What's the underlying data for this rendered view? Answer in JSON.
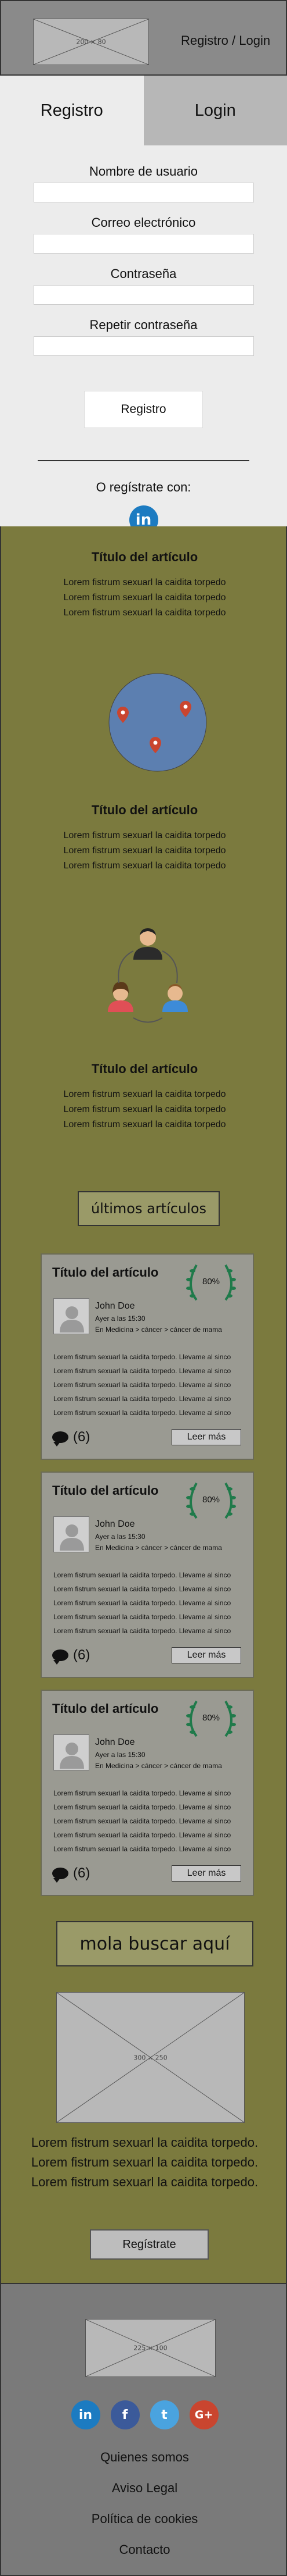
{
  "header": {
    "logo_label": "200 × 80",
    "link": "Registro / Login"
  },
  "auth": {
    "tabs": [
      {
        "label": "Registro"
      },
      {
        "label": "Login"
      }
    ],
    "fields": [
      {
        "label": "Nombre de usuario",
        "value": ""
      },
      {
        "label": "Correo electrónico",
        "value": ""
      },
      {
        "label": "Contraseña",
        "value": ""
      },
      {
        "label": "Repetir contraseña",
        "value": ""
      }
    ],
    "submit_label": "Registro",
    "or_text": "O regístrate con:",
    "linkedin_glyph": "in"
  },
  "articles": [
    {
      "title": "Título del artículo",
      "lines": [
        "Lorem fistrum sexuarl la caidita torpedo",
        "Lorem fistrum sexuarl la caidita torpedo",
        "Lorem fistrum sexuarl la caidita torpedo"
      ]
    },
    {
      "title": "Título del artículo",
      "lines": [
        "Lorem fistrum sexuarl la caidita torpedo",
        "Lorem fistrum sexuarl la caidita torpedo",
        "Lorem fistrum sexuarl la caidita torpedo"
      ]
    },
    {
      "title": "Título del artículo",
      "lines": [
        "Lorem fistrum sexuarl la caidita torpedo",
        "Lorem fistrum sexuarl la caidita torpedo",
        "Lorem fistrum sexuarl la caidita torpedo"
      ]
    }
  ],
  "latest_heading": "últimos artículos",
  "cards": [
    {
      "title": "Título del artículo",
      "rating": "80%",
      "author": "John Doe",
      "date": "Ayer a las 15:30",
      "category": "En Medicina > cáncer > cáncer de mama",
      "excerpt": [
        "Lorem fistrum sexuarl la caidita torpedo. Llevame al sinco",
        "Lorem fistrum sexuarl la caidita torpedo. Llevame al sinco",
        "Lorem fistrum sexuarl la caidita torpedo. Llevame al sinco",
        "Lorem fistrum sexuarl la caidita torpedo. Llevame al sinco",
        "Lorem fistrum sexuarl la caidita torpedo. Llevame al sinco"
      ],
      "comments": "(6)",
      "more_label": "Leer más"
    },
    {
      "title": "Título del artículo",
      "rating": "80%",
      "author": "John Doe",
      "date": "Ayer a las 15:30",
      "category": "En Medicina > cáncer > cáncer de mama",
      "excerpt": [
        "Lorem fistrum sexuarl la caidita torpedo. Llevame al sinco",
        "Lorem fistrum sexuarl la caidita torpedo. Llevame al sinco",
        "Lorem fistrum sexuarl la caidita torpedo. Llevame al sinco",
        "Lorem fistrum sexuarl la caidita torpedo. Llevame al sinco",
        "Lorem fistrum sexuarl la caidita torpedo. Llevame al sinco"
      ],
      "comments": "(6)",
      "more_label": "Leer más"
    },
    {
      "title": "Título del artículo",
      "rating": "80%",
      "author": "John Doe",
      "date": "Ayer a las 15:30",
      "category": "En Medicina > cáncer > cáncer de mama",
      "excerpt": [
        "Lorem fistrum sexuarl la caidita torpedo. Llevame al sinco",
        "Lorem fistrum sexuarl la caidita torpedo. Llevame al sinco",
        "Lorem fistrum sexuarl la caidita torpedo. Llevame al sinco",
        "Lorem fistrum sexuarl la caidita torpedo. Llevame al sinco",
        "Lorem fistrum sexuarl la caidita torpedo. Llevame al sinco"
      ],
      "comments": "(6)",
      "more_label": "Leer más"
    }
  ],
  "search_banner": "mola buscar aquí",
  "promo": {
    "image_label": "300 × 250",
    "lines": [
      "Lorem fistrum sexuarl la caidita torpedo.",
      "Lorem fistrum sexuarl la caidita torpedo.",
      "Lorem fistrum sexuarl la caidita torpedo."
    ],
    "button_label": "Regístrate"
  },
  "footer": {
    "logo_label": "225 × 100",
    "socials": [
      {
        "icon": "linkedin-icon",
        "glyph": "in",
        "color": "#1c7bc1"
      },
      {
        "icon": "facebook-icon",
        "glyph": "f",
        "color": "#3b5a9a"
      },
      {
        "icon": "twitter-icon",
        "glyph": "t",
        "color": "#4aa3df"
      },
      {
        "icon": "googleplus-icon",
        "glyph": "G+",
        "color": "#c9452f"
      }
    ],
    "links": [
      "Quienes somos",
      "Aviso Legal",
      "Política de cookies",
      "Contacto"
    ]
  }
}
